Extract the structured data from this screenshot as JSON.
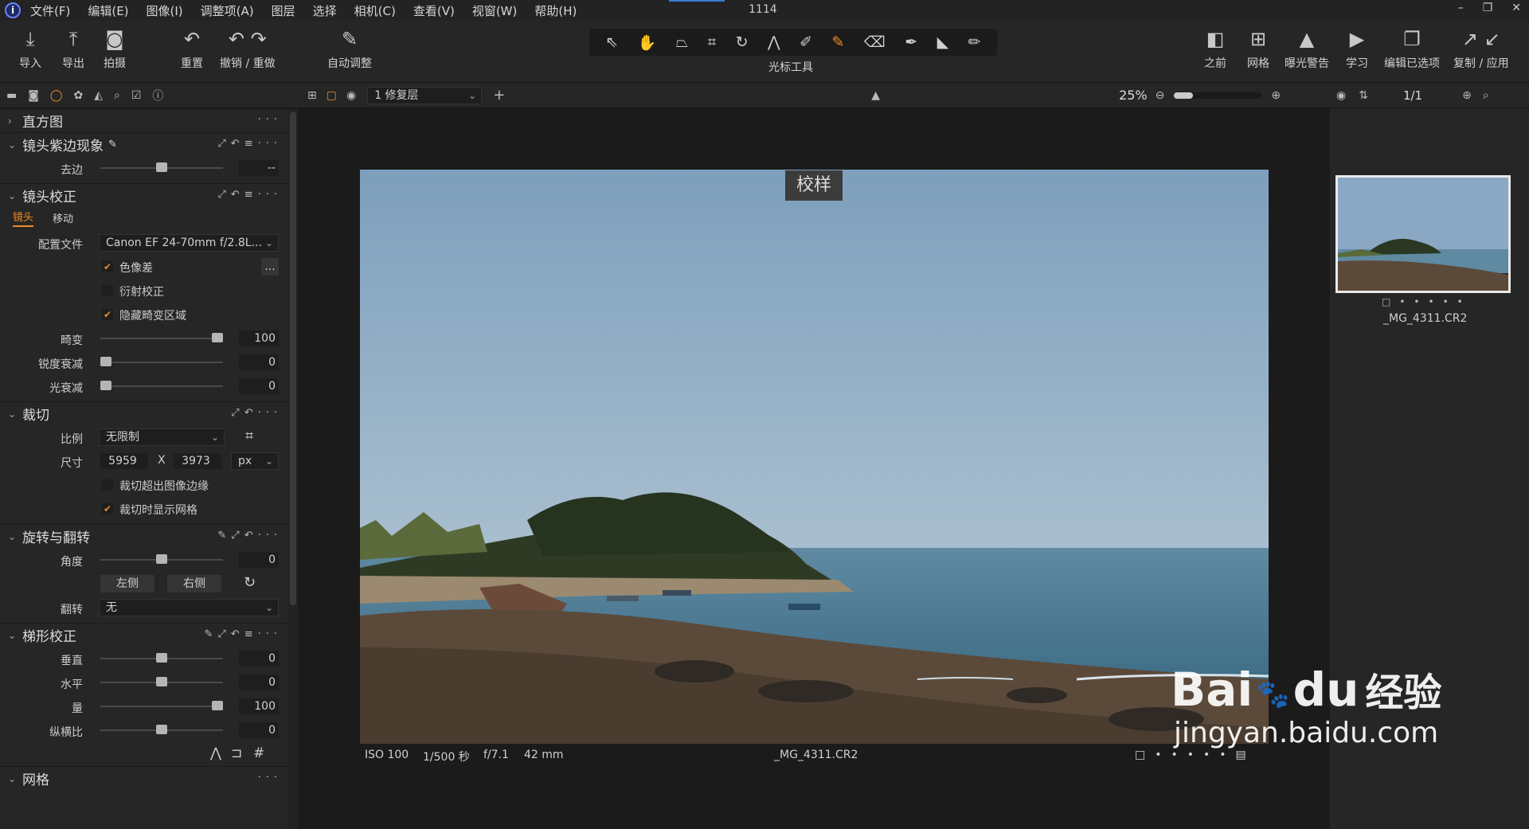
{
  "menu": {
    "items": [
      "文件(F)",
      "编辑(E)",
      "图像(I)",
      "调整项(A)",
      "图层",
      "选择",
      "相机(C)",
      "查看(V)",
      "视窗(W)",
      "帮助(H)"
    ],
    "window_title": "1114"
  },
  "toolbar": {
    "import": "导入",
    "export": "导出",
    "capture": "拍摄",
    "reset": "重置",
    "undo_redo": "撤销 / 重做",
    "auto_adjust": "自动调整",
    "cursor_tools": "光标工具",
    "before": "之前",
    "grid": "网格",
    "exposure_warning": "曝光警告",
    "learn": "学习",
    "edit_selected": "编辑已选项",
    "copy_apply": "复制 / 应用"
  },
  "viewer_bar": {
    "layer": "1 修复层",
    "zoom": "25%"
  },
  "browser_bar": {
    "count": "1/1"
  },
  "panel": {
    "histogram": "直方图",
    "purple_fringe": {
      "title": "镜头紫边现象",
      "defringe_label": "去边",
      "defringe_value": "--"
    },
    "lens_correction": {
      "title": "镜头校正",
      "tab_lens": "镜头",
      "tab_move": "移动",
      "profile_label": "配置文件",
      "profile_value": "Canon EF 24-70mm f/2.8L...",
      "chromatic": "色像差",
      "chromatic_more": "...",
      "diffraction": "衍射校正",
      "hide_distorted": "隐藏畸变区域",
      "distortion_label": "畸变",
      "distortion_value": "100",
      "distortion_level": 100,
      "sharpness_label": "锐度衰减",
      "sharpness_value": "0",
      "sharpness_level": 0,
      "light_label": "光衰减",
      "light_value": "0",
      "light_level": 0
    },
    "crop": {
      "title": "裁切",
      "ratio_label": "比例",
      "ratio_value": "无限制",
      "size_label": "尺寸",
      "width": "5959",
      "x": "X",
      "height": "3973",
      "unit": "px",
      "outside": "裁切超出图像边缘",
      "show_grid": "裁切时显示网格"
    },
    "rotate": {
      "title": "旋转与翻转",
      "angle_label": "角度",
      "angle_value": "0",
      "angle_level": 0,
      "left": "左侧",
      "right": "右侧",
      "flip_label": "翻转",
      "flip_value": "无"
    },
    "keystone": {
      "title": "梯形校正",
      "vertical_label": "垂直",
      "vertical_value": "0",
      "vertical_level": 0,
      "horizontal_label": "水平",
      "horizontal_value": "0",
      "horizontal_level": 0,
      "amount_label": "量",
      "amount_value": "100",
      "amount_level": 100,
      "aspect_label": "纵横比",
      "aspect_value": "0",
      "aspect_level": 0
    },
    "grid_section": "网格"
  },
  "viewer": {
    "proof": "校样",
    "iso": "ISO 100",
    "shutter": "1/500 秒",
    "aperture": "f/7.1",
    "focal": "42 mm",
    "filename": "_MG_4311.CR2"
  },
  "browser": {
    "thumb_name": "_MG_4311.CR2"
  },
  "watermark": {
    "brand": "Bai",
    "du": "du",
    "cn": "经验",
    "url": "jingyan.baidu.com"
  },
  "colors": {
    "accent": "#f08a24",
    "panel": "#262626",
    "viewer": "#1b1b1b"
  }
}
